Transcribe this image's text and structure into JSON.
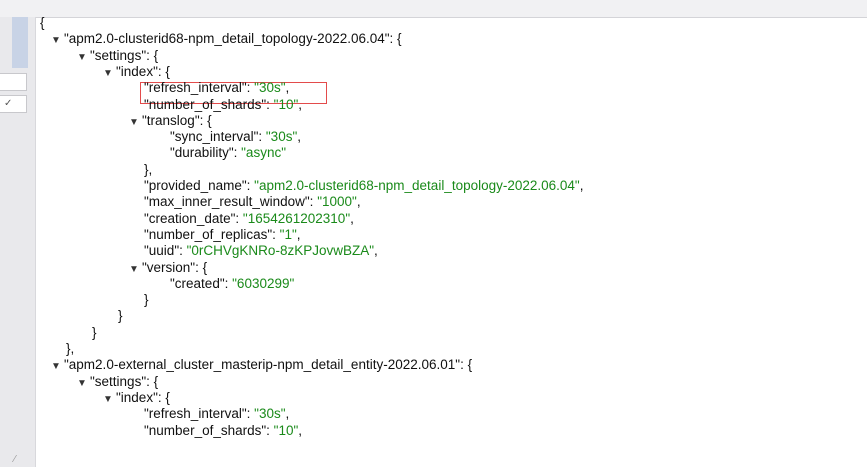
{
  "brand": {
    "string_color": "#1a8a1a",
    "key_color": "#111111",
    "highlight_color": "#e34b4b"
  },
  "left_panel": {
    "checkbox_mark": "✓",
    "resize_mark": "⁄"
  },
  "json_lines": [
    {
      "indent": 0,
      "toggle": false,
      "text": "{"
    },
    {
      "indent": 1,
      "toggle": true,
      "key": "\"apm2.0-clusterid68-npm_detail_topology-2022.06.04\"",
      "suffix": ": {"
    },
    {
      "indent": 2,
      "toggle": true,
      "key": "\"settings\"",
      "suffix": ": {"
    },
    {
      "indent": 3,
      "toggle": true,
      "key": "\"index\"",
      "suffix": ": {"
    },
    {
      "indent": 4,
      "toggle": false,
      "key": "\"refresh_interval\"",
      "sep": ": ",
      "value": "\"30s\"",
      "trail": ","
    },
    {
      "indent": 4,
      "toggle": false,
      "key": "\"number_of_shards\"",
      "sep": ": ",
      "value": "\"10\"",
      "trail": ","
    },
    {
      "indent": 4,
      "toggle": true,
      "key": "\"translog\"",
      "suffix": ": {"
    },
    {
      "indent": 5,
      "toggle": false,
      "key": "\"sync_interval\"",
      "sep": ": ",
      "value": "\"30s\"",
      "trail": ","
    },
    {
      "indent": 5,
      "toggle": false,
      "key": "\"durability\"",
      "sep": ": ",
      "value": "\"async\"",
      "trail": ""
    },
    {
      "indent": 4,
      "toggle": false,
      "text": "},"
    },
    {
      "indent": 4,
      "toggle": false,
      "key": "\"provided_name\"",
      "sep": ": ",
      "value": "\"apm2.0-clusterid68-npm_detail_topology-2022.06.04\"",
      "trail": ","
    },
    {
      "indent": 4,
      "toggle": false,
      "key": "\"max_inner_result_window\"",
      "sep": ": ",
      "value": "\"1000\"",
      "trail": ","
    },
    {
      "indent": 4,
      "toggle": false,
      "key": "\"creation_date\"",
      "sep": ": ",
      "value": "\"1654261202310\"",
      "trail": ","
    },
    {
      "indent": 4,
      "toggle": false,
      "key": "\"number_of_replicas\"",
      "sep": ": ",
      "value": "\"1\"",
      "trail": ","
    },
    {
      "indent": 4,
      "toggle": false,
      "key": "\"uuid\"",
      "sep": ": ",
      "value": "\"0rCHVgKNRo-8zKPJovwBZA\"",
      "trail": ","
    },
    {
      "indent": 4,
      "toggle": true,
      "key": "\"version\"",
      "suffix": ": {"
    },
    {
      "indent": 5,
      "toggle": false,
      "key": "\"created\"",
      "sep": ": ",
      "value": "\"6030299\"",
      "trail": ""
    },
    {
      "indent": 4,
      "toggle": false,
      "text": "}"
    },
    {
      "indent": 3,
      "toggle": false,
      "text": "}"
    },
    {
      "indent": 2,
      "toggle": false,
      "text": "}"
    },
    {
      "indent": 1,
      "toggle": false,
      "text": "},"
    },
    {
      "indent": 1,
      "toggle": true,
      "key": "\"apm2.0-external_cluster_masterip-npm_detail_entity-2022.06.01\"",
      "suffix": ": {"
    },
    {
      "indent": 2,
      "toggle": true,
      "key": "\"settings\"",
      "suffix": ": {"
    },
    {
      "indent": 3,
      "toggle": true,
      "key": "\"index\"",
      "suffix": ": {"
    },
    {
      "indent": 4,
      "toggle": false,
      "key": "\"refresh_interval\"",
      "sep": ": ",
      "value": "\"30s\"",
      "trail": ","
    },
    {
      "indent": 4,
      "toggle": false,
      "key": "\"number_of_shards\"",
      "sep": ": ",
      "value": "\"10\"",
      "trail": ","
    }
  ]
}
